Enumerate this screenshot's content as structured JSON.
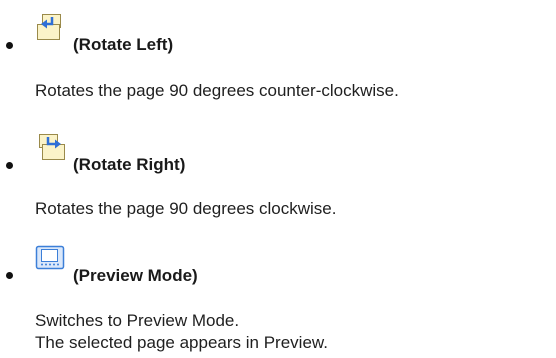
{
  "items": [
    {
      "icon": "rotate-left-icon",
      "title": "(Rotate Left)",
      "description_lines": [
        "Rotates the page 90 degrees counter-clockwise."
      ]
    },
    {
      "icon": "rotate-right-icon",
      "title": "(Rotate Right)",
      "description_lines": [
        "Rotates the page 90 degrees clockwise."
      ]
    },
    {
      "icon": "preview-mode-icon",
      "title": "(Preview Mode)",
      "description_lines": [
        "Switches to Preview Mode.",
        "The selected page appears in Preview."
      ]
    }
  ],
  "colors": {
    "page_fill": "#fbf3c8",
    "page_stroke": "#9a8a4a",
    "arrow_blue": "#2f6fd6",
    "preview_blue": "#3c7fd8"
  }
}
